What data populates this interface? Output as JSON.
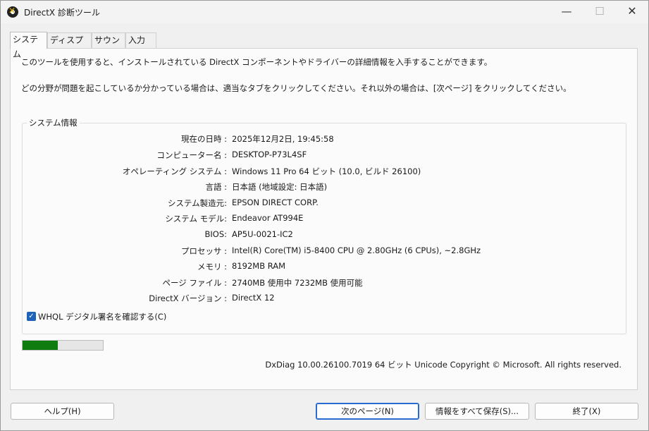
{
  "window": {
    "title": "DirectX 診断ツール",
    "minimize_glyph": "—",
    "maximize_glyph": "☐",
    "close_glyph": "✕"
  },
  "tabs": [
    {
      "label": "システム"
    },
    {
      "label": "ディスプレイ"
    },
    {
      "label": "サウンド"
    },
    {
      "label": "入力"
    }
  ],
  "intro": {
    "line1": "このツールを使用すると、インストールされている DirectX コンポーネントやドライバーの詳細情報を入手することができます。",
    "line2": "どの分野が問題を起こしているか分かっている場合は、適当なタブをクリックしてください。それ以外の場合は、[次ページ] をクリックしてください。"
  },
  "system_info": {
    "title": "システム情報",
    "rows": [
      {
        "label": "現在の日時 :",
        "value": "2025年12月2日, 19:45:58"
      },
      {
        "label": "コンピューター名 :",
        "value": "DESKTOP-P73L4SF"
      },
      {
        "label": "オペレーティング システム :",
        "value": "Windows 11 Pro 64 ビット (10.0, ビルド 26100)"
      },
      {
        "label": "言語 :",
        "value": "日本語 (地域設定: 日本語)"
      },
      {
        "label": "システム製造元:",
        "value": "EPSON DIRECT CORP."
      },
      {
        "label": "システム モデル:",
        "value": "Endeavor AT994E"
      },
      {
        "label": "BIOS:",
        "value": "AP5U-0021-IC2"
      },
      {
        "label": "プロセッサ :",
        "value": "Intel(R) Core(TM) i5-8400 CPU @ 2.80GHz (6 CPUs), ~2.8GHz"
      },
      {
        "label": "メモリ :",
        "value": "8192MB RAM"
      },
      {
        "label": "ページ ファイル :",
        "value": "2740MB 使用中 7232MB 使用可能"
      },
      {
        "label": "DirectX バージョン :",
        "value": "DirectX 12"
      }
    ],
    "whql_checkbox": {
      "label": "WHQL デジタル署名を確認する(C)",
      "checked": true
    }
  },
  "progress": {
    "fraction": 0.44,
    "color": "#0f7c10"
  },
  "footer": "DxDiag 10.00.26100.7019 64 ビット Unicode  Copyright © Microsoft. All rights reserved.",
  "buttons": {
    "help": "ヘルプ(H)",
    "next": "次のページ(N)",
    "save_all": "情報をすべて保存(S)...",
    "exit": "終了(X)"
  }
}
